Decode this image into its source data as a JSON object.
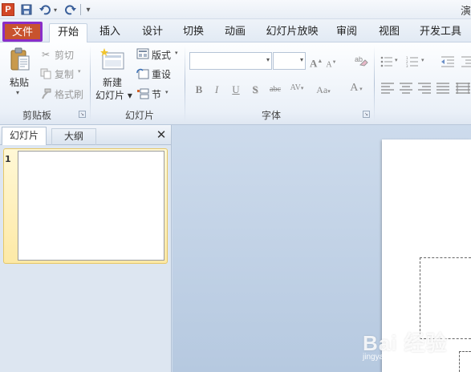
{
  "app": {
    "icon_letter": "P",
    "title_fragment": "演"
  },
  "quick_access": {
    "more_label": "▾"
  },
  "tabs": [
    {
      "id": "file",
      "label": "文件"
    },
    {
      "id": "home",
      "label": "开始"
    },
    {
      "id": "insert",
      "label": "插入"
    },
    {
      "id": "design",
      "label": "设计"
    },
    {
      "id": "transition",
      "label": "切换"
    },
    {
      "id": "animation",
      "label": "动画"
    },
    {
      "id": "slideshow",
      "label": "幻灯片放映"
    },
    {
      "id": "review",
      "label": "审阅"
    },
    {
      "id": "view",
      "label": "视图"
    },
    {
      "id": "developer",
      "label": "开发工具"
    }
  ],
  "ribbon": {
    "clipboard": {
      "paste": "粘贴",
      "cut": "剪切",
      "copy": "复制",
      "format_painter": "格式刷",
      "group_label": "剪贴板"
    },
    "slides": {
      "new_slide_line1": "新建",
      "new_slide_line2": "幻灯片",
      "layout": "版式",
      "reset": "重设",
      "section": "节",
      "group_label": "幻灯片"
    },
    "font": {
      "font_name": "",
      "font_size": "",
      "grow": "A",
      "shrink": "A",
      "bold": "B",
      "italic": "I",
      "underline": "U",
      "shadow": "S",
      "strike": "abc",
      "spacing": "AV",
      "case": "Aa",
      "color": "A",
      "group_label": "字体"
    }
  },
  "pane": {
    "tab_slides": "幻灯片",
    "tab_outline": "大纲",
    "close": "✕",
    "slides": [
      {
        "number": "1"
      }
    ]
  },
  "watermark": {
    "main": "Bai 经验",
    "sub": "jingyan.baidu.com"
  },
  "colors": {
    "file_tab": "#c8532e",
    "file_tab_highlight": "#8a2ec8",
    "selected_thumb": "#fde9a6"
  }
}
